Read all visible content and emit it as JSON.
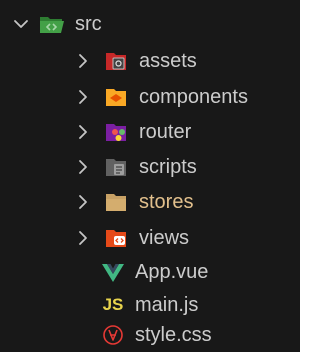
{
  "tree": {
    "root": {
      "label": "src",
      "icon": "folder-src-open-icon",
      "expanded": true,
      "color": "#cccccc"
    },
    "items": [
      {
        "label": "assets",
        "type": "folder",
        "icon": "folder-assets-icon",
        "color": "#cccccc"
      },
      {
        "label": "components",
        "type": "folder",
        "icon": "folder-components-icon",
        "color": "#cccccc"
      },
      {
        "label": "router",
        "type": "folder",
        "icon": "folder-router-icon",
        "color": "#cccccc"
      },
      {
        "label": "scripts",
        "type": "folder",
        "icon": "folder-scripts-icon",
        "color": "#cccccc"
      },
      {
        "label": "stores",
        "type": "folder",
        "icon": "folder-stores-icon",
        "color": "#e2c08d"
      },
      {
        "label": "views",
        "type": "folder",
        "icon": "folder-views-icon",
        "color": "#cccccc"
      },
      {
        "label": "App.vue",
        "type": "file",
        "icon": "vue-file-icon",
        "color": "#cccccc"
      },
      {
        "label": "main.js",
        "type": "file",
        "icon": "js-file-icon",
        "badge": "JS",
        "color": "#cccccc"
      },
      {
        "label": "style.css",
        "type": "file",
        "icon": "css-file-icon",
        "color": "#cccccc"
      }
    ]
  }
}
